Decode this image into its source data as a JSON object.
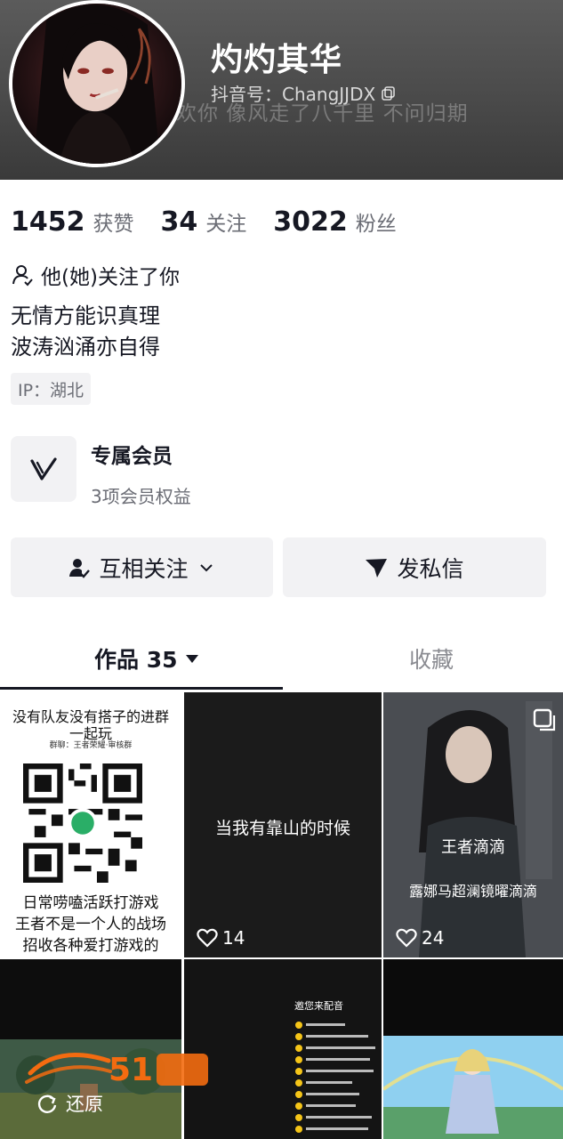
{
  "profile": {
    "name": "灼灼其华",
    "douyin_id": "抖音号：ChangJJDX",
    "banner_slogan": "欢你  像风走了八千里  不问归期"
  },
  "stats": [
    {
      "value": "1452",
      "label": "获赞"
    },
    {
      "value": "34",
      "label": "关注"
    },
    {
      "value": "3022",
      "label": "粉丝"
    }
  ],
  "relation": "他(她)关注了你",
  "bio": [
    "无情方能识真理",
    "波涛汹涌亦自得"
  ],
  "ip": "IP：湖北",
  "membership": {
    "title": "专属会员",
    "subtitle": "3项会员权益"
  },
  "actions": {
    "follow": "互相关注",
    "message": "发私信"
  },
  "tabs": {
    "works": "作品 35",
    "favorites": "收藏"
  },
  "videos": [
    {
      "title_top": "没有队友没有搭子的进群",
      "title_top2": "一起玩",
      "sub": "群聊：王者荣耀·审核群",
      "lines": [
        "日常唠嗑活跃打游戏",
        "王者不是一个人的战场",
        "招收各种爱打游戏的"
      ]
    },
    {
      "caption": "当我有靠山的时候",
      "likes": "14"
    },
    {
      "caption1": "王者滴滴",
      "caption2": "露娜马超澜镜曜滴滴",
      "likes": "24"
    },
    {},
    {
      "header": "邀您来配音"
    },
    {}
  ],
  "restore": "还原",
  "colors": {
    "text": "#161823",
    "secondary": "#6b6d75",
    "button_bg": "#f2f2f4",
    "watermark": "#f36b10"
  }
}
